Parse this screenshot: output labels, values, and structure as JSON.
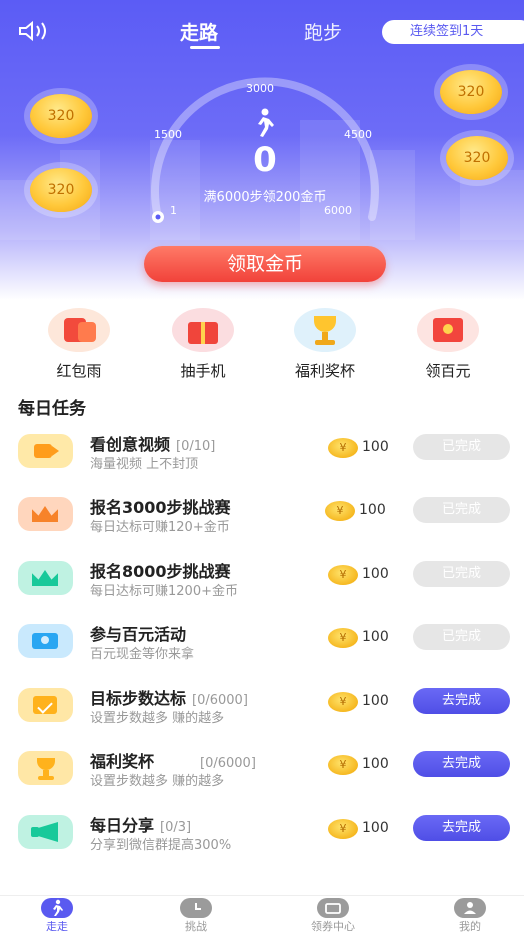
{
  "header": {
    "tabs": [
      {
        "label": "走路"
      },
      {
        "label": "跑步"
      }
    ],
    "signin": "连续签到1天",
    "coins": [
      "320",
      "320",
      "320",
      "320"
    ],
    "dial": {
      "labels": [
        "3000",
        "1500",
        "4500",
        "1",
        "6000"
      ]
    },
    "steps": "0",
    "goal_text": "满6000步领200金币",
    "claim_button": "领取金币"
  },
  "features": [
    {
      "label": "红包雨",
      "icon": "red-envelope-icon"
    },
    {
      "label": "抽手机",
      "icon": "gift-box-icon"
    },
    {
      "label": "福利奖杯",
      "icon": "trophy-icon"
    },
    {
      "label": "领百元",
      "icon": "cash-envelope-icon"
    }
  ],
  "section_title": "每日任务",
  "tasks": [
    {
      "title": "看创意视频",
      "count": "[0/10]",
      "subtitle": "海量视频 上不封顶",
      "coin": "¥",
      "reward": "100",
      "button": "已完成",
      "done": true,
      "icon": "video-icon",
      "color": "#ffcf5a"
    },
    {
      "title": "报名3000步挑战赛",
      "count": "",
      "subtitle": "每日达标可赚120+金币",
      "coin": "¥",
      "reward": "100",
      "button": "已完成",
      "done": true,
      "icon": "crown-icon",
      "color": "#ff9f5a"
    },
    {
      "title": "报名8000步挑战赛",
      "count": "",
      "subtitle": "每日达标可赚1200+金币",
      "coin": "¥",
      "reward": "100",
      "button": "已完成",
      "done": true,
      "icon": "crown-icon",
      "color": "#2dd7a8"
    },
    {
      "title": "参与百元活动",
      "count": "",
      "subtitle": "百元现金等你来拿",
      "coin": "¥",
      "reward": "100",
      "button": "已完成",
      "done": true,
      "icon": "ticket-icon",
      "color": "#49b8f5"
    },
    {
      "title": "目标步数达标",
      "count": "[0/6000]",
      "subtitle": "设置步数越多 赚的越多",
      "coin": "¥",
      "reward": "100",
      "button": "去完成",
      "done": false,
      "icon": "calendar-icon",
      "color": "#ffc43d"
    },
    {
      "title": "福利奖杯",
      "count": "[0/6000]",
      "subtitle": "设置步数越多 赚的越多",
      "coin": "¥",
      "reward": "100",
      "button": "去完成",
      "done": false,
      "icon": "trophy-icon",
      "color": "#ffc43d"
    },
    {
      "title": "每日分享",
      "count": "[0/3]",
      "subtitle": "分享到微信群提高300%",
      "coin": "¥",
      "reward": "100",
      "button": "去完成",
      "done": false,
      "icon": "megaphone-icon",
      "color": "#2dd7a8"
    }
  ],
  "tabbar": [
    {
      "label": "走走",
      "icon": "walk-icon",
      "active": true
    },
    {
      "label": "挑战",
      "icon": "clock-icon",
      "active": false
    },
    {
      "label": "领券中心",
      "icon": "coupon-icon",
      "active": false
    },
    {
      "label": "我的",
      "icon": "profile-icon",
      "active": false
    }
  ]
}
